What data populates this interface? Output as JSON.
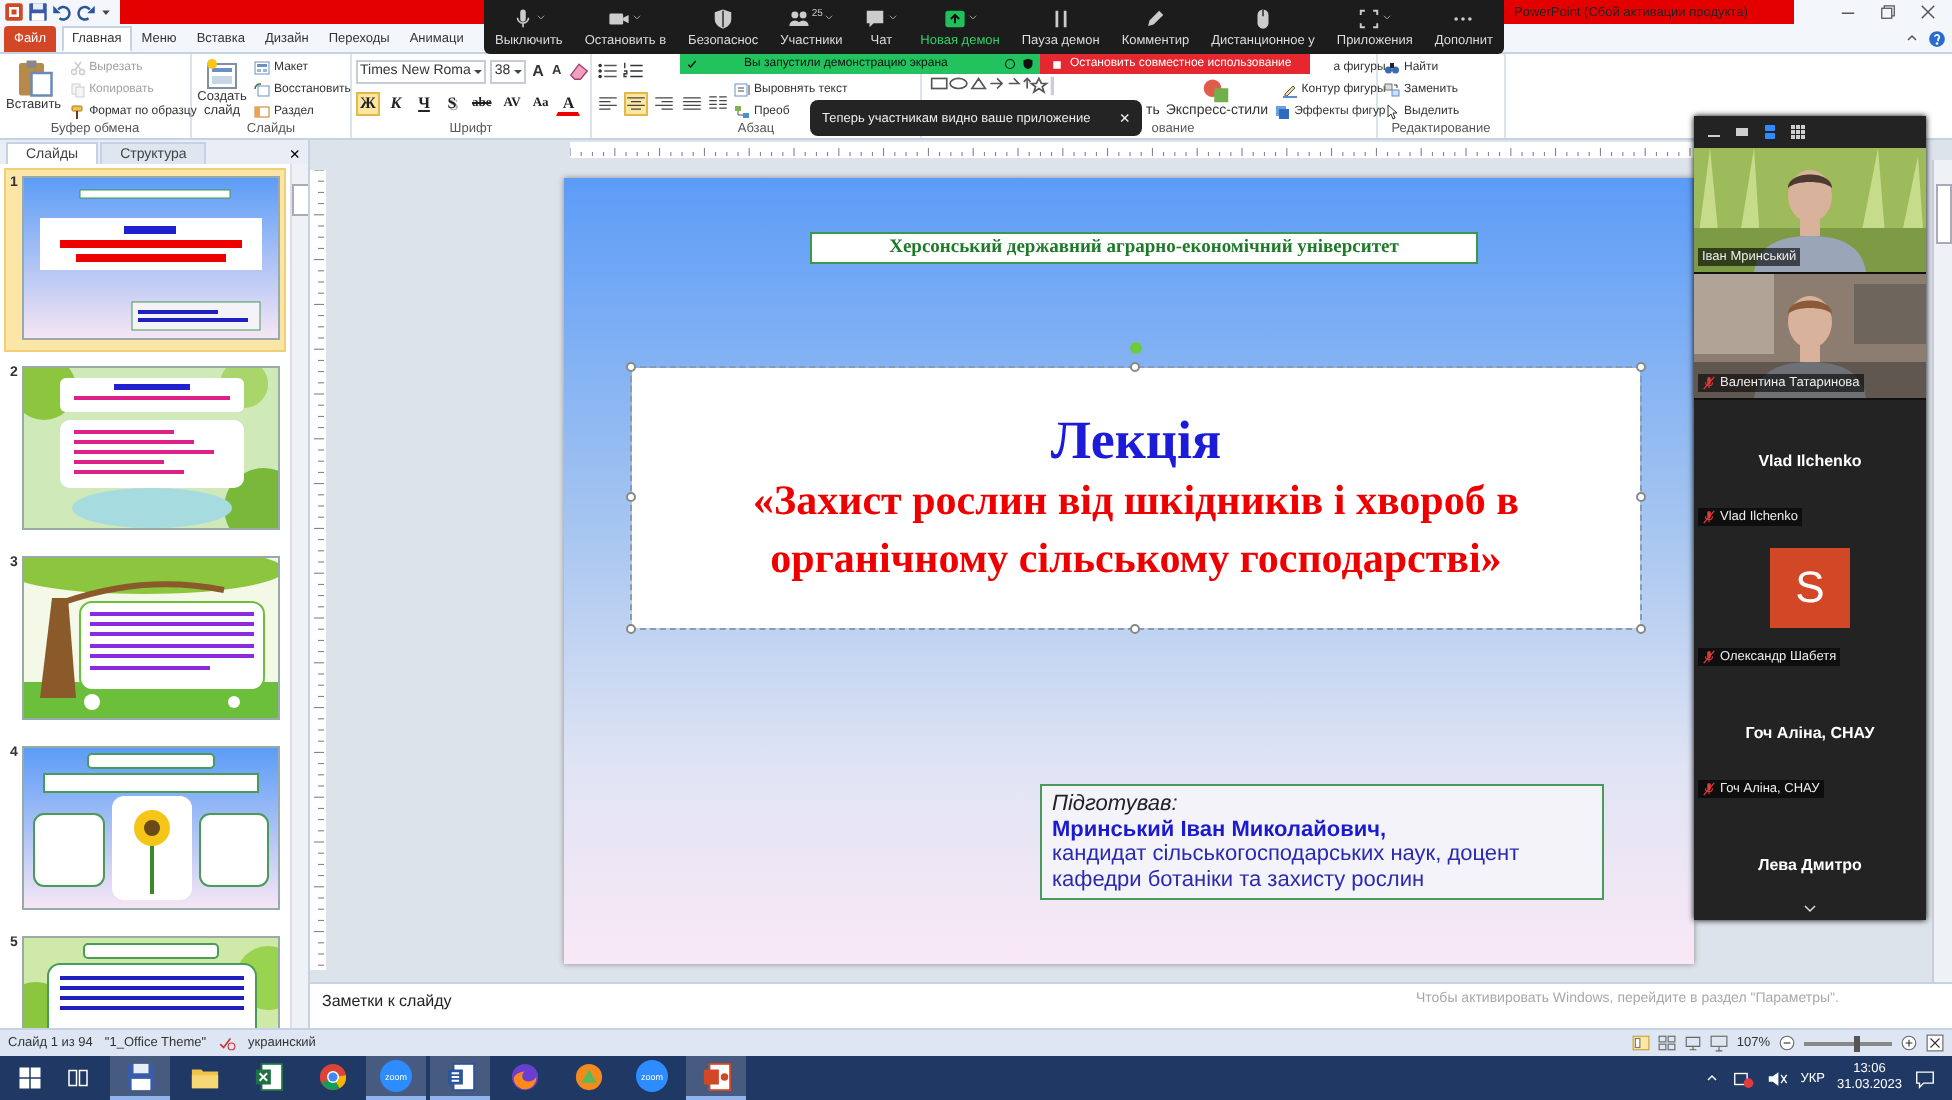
{
  "window": {
    "title": "PowerPoint (Сбой активации продукта)"
  },
  "ribbon_tabs": [
    {
      "label": "Файл",
      "kind": "file",
      "selected": false
    },
    {
      "label": "Главная",
      "kind": "tab",
      "selected": true
    },
    {
      "label": "Меню",
      "kind": "tab",
      "selected": false
    },
    {
      "label": "Вставка",
      "kind": "tab",
      "selected": false
    },
    {
      "label": "Дизайн",
      "kind": "tab",
      "selected": false
    },
    {
      "label": "Переходы",
      "kind": "tab",
      "selected": false
    },
    {
      "label": "Анимаци",
      "kind": "tab",
      "selected": false
    }
  ],
  "ribbon_groups": [
    {
      "label": "Буфер обмена",
      "kind": "clipboard",
      "large": [
        {
          "label": "Вставить",
          "kind": "paste"
        }
      ],
      "small": [
        {
          "label": "Вырезать",
          "kind": "cut",
          "disabled": true
        },
        {
          "label": "Копировать",
          "kind": "copy",
          "disabled": true
        },
        {
          "label": "Формат по образцу",
          "kind": "brush",
          "disabled": false
        }
      ]
    },
    {
      "label": "Слайды",
      "kind": "slides",
      "large": [
        {
          "label": "Создать слайд",
          "kind": "newslide"
        }
      ],
      "small": [
        {
          "label": "Макет",
          "kind": "layout",
          "disabled": false
        },
        {
          "label": "Восстановить",
          "kind": "reset",
          "disabled": false
        },
        {
          "label": "Раздел",
          "kind": "section",
          "disabled": false
        }
      ]
    },
    {
      "label": "Шрифт",
      "kind": "font",
      "font": "Times New Roma",
      "size": "38",
      "tools": [
        {
          "label": "A",
          "kind": "grow"
        },
        {
          "label": "A",
          "kind": "shrink"
        },
        {
          "kind": "clear"
        }
      ],
      "format": [
        {
          "label": "Ж",
          "kind": "bold",
          "selected": true
        },
        {
          "label": "К",
          "kind": "italic",
          "selected": false
        },
        {
          "label": "Ч",
          "kind": "underline",
          "selected": false
        },
        {
          "label": "S",
          "kind": "shadow",
          "selected": false
        },
        {
          "label": "abe",
          "kind": "strike",
          "selected": false
        },
        {
          "label": "AV",
          "kind": "spacing",
          "selected": false
        },
        {
          "label": "Aa",
          "kind": "case",
          "selected": false
        },
        {
          "label": "A",
          "kind": "color",
          "selected": false
        }
      ]
    },
    {
      "label": "Абзац",
      "kind": "paragraph",
      "align": [
        {
          "kind": "left",
          "selected": false
        },
        {
          "kind": "center",
          "selected": true
        },
        {
          "kind": "right",
          "selected": false
        },
        {
          "kind": "justify",
          "selected": false
        }
      ],
      "small": [
        {
          "label": "Выровнять текст",
          "kind": "aligntext",
          "disabled": false
        },
        {
          "label": "Преоб",
          "kind": "smartart",
          "disabled": false
        }
      ]
    },
    {
      "label": "ование",
      "kind": "drawing",
      "large": [
        {
          "label": "ть",
          "kind": "arrange"
        },
        {
          "label": "Экспресс-стили",
          "kind": "styles"
        }
      ],
      "small": [
        {
          "label": "а фигуры",
          "disabled": false
        },
        {
          "label": "Контур фигуры",
          "kind": "outline",
          "disabled": false
        },
        {
          "label": "Эффекты фигур",
          "kind": "effects",
          "disabled": false
        }
      ]
    },
    {
      "label": "Редактирование",
      "kind": "editing",
      "small": [
        {
          "label": "Найти",
          "kind": "find",
          "disabled": false
        },
        {
          "label": "Заменить",
          "kind": "replace",
          "disabled": false
        },
        {
          "label": "Выделить",
          "kind": "select",
          "disabled": false
        }
      ]
    }
  ],
  "left_pane": {
    "tabs": [
      {
        "label": "Слайды",
        "selected": true
      },
      {
        "label": "Структура",
        "selected": false
      }
    ],
    "close": "×"
  },
  "thumbnails": [
    {
      "number": "1",
      "kind": "title",
      "selected": true
    },
    {
      "number": "2",
      "kind": "leaves",
      "selected": false
    },
    {
      "number": "3",
      "kind": "tree",
      "selected": false
    },
    {
      "number": "4",
      "kind": "sunflower",
      "selected": false
    },
    {
      "number": "5",
      "kind": "meadow",
      "selected": false
    }
  ],
  "slide": {
    "header": "Херсонський державний аграрно-економічний університет",
    "title_box": {
      "selected": true,
      "heading": "Лекція",
      "subtitle": "«Захист рослин від шкідників і хвороб в органічному сільському господарстві»"
    },
    "author_box": {
      "label": "Підготував:",
      "name": "Мринський Іван Миколайович,",
      "credentials": "кандидат сільськогосподарських наук, доцент кафедри ботаніки та захисту рослин"
    }
  },
  "notes": {
    "placeholder": "Заметки к слайду"
  },
  "activation_notice": "Чтобы активировать Windows, перейдите в раздел \"Параметры\".",
  "status_bar": {
    "slide": "Слайд 1 из 94",
    "theme": "\"1_Office Theme\"",
    "language": "украинский",
    "zoom": "107%",
    "zoom_slider": {
      "level": 0.62
    }
  },
  "zoom_toolbar": [
    {
      "label": "Выключить",
      "kind": "mic",
      "dropdown": true
    },
    {
      "label": "Остановить в",
      "kind": "video",
      "dropdown": true
    },
    {
      "label": "Безопаснос",
      "kind": "shield",
      "dropdown": false
    },
    {
      "label": "Участники",
      "kind": "people",
      "count": "25",
      "dropdown": true
    },
    {
      "label": "Чат",
      "kind": "chat",
      "dropdown": true
    },
    {
      "label": "Новая демон",
      "kind": "share",
      "dropdown": true
    },
    {
      "label": "Пауза демон",
      "kind": "pause",
      "dropdown": false
    },
    {
      "label": "Комментир",
      "kind": "pen",
      "dropdown": false
    },
    {
      "label": "Дистанционное у",
      "kind": "mouse",
      "dropdown": false
    },
    {
      "label": "Приложения",
      "kind": "apps",
      "dropdown": true
    },
    {
      "label": "Дополнит",
      "kind": "more",
      "dropdown": false
    }
  ],
  "share_banner": {
    "text": "Вы запустили демонстрацию экрана"
  },
  "stop_banner": {
    "text": "Остановить совместное использование"
  },
  "notice": {
    "text": "Теперь участникам видно ваше приложение",
    "close": "×"
  },
  "participants": {
    "views": [
      {
        "kind": "minimize",
        "selected": false
      },
      {
        "kind": "speaker",
        "selected": false
      },
      {
        "kind": "strip",
        "selected": true
      },
      {
        "kind": "grid",
        "selected": false
      }
    ],
    "tiles": [
      {
        "kind": "video",
        "name": "Іван Мринський",
        "muted": false
      },
      {
        "kind": "video",
        "name": "Валентина Татаринова",
        "muted": true
      },
      {
        "kind": "name",
        "title": "Vlad Ilchenko",
        "name": "Vlad Ilchenko",
        "muted": true
      },
      {
        "kind": "avatar",
        "letter": "S",
        "color": "#d24726",
        "name": "Олександр Шабетя",
        "muted": true
      },
      {
        "kind": "name",
        "title": "Гоч Аліна, СНАУ",
        "name": "Гоч Аліна, СНАУ",
        "muted": true
      },
      {
        "kind": "name",
        "title": "Лева Дмитро"
      }
    ]
  },
  "taskbar": {
    "items": [
      {
        "kind": "save",
        "selected": true
      },
      {
        "kind": "folder",
        "selected": false
      },
      {
        "kind": "excel",
        "selected": false
      },
      {
        "kind": "chrome",
        "selected": false
      },
      {
        "kind": "zoom",
        "label": "zoom",
        "selected": true
      },
      {
        "kind": "word",
        "selected": true
      },
      {
        "kind": "firefox",
        "selected": false
      },
      {
        "kind": "app",
        "selected": false
      },
      {
        "kind": "zoom",
        "label": "zoom",
        "selected": false
      },
      {
        "kind": "powerpoint",
        "selected": true
      }
    ],
    "keyboard": "УКР",
    "time": "13:06",
    "date": "31.03.2023"
  }
}
